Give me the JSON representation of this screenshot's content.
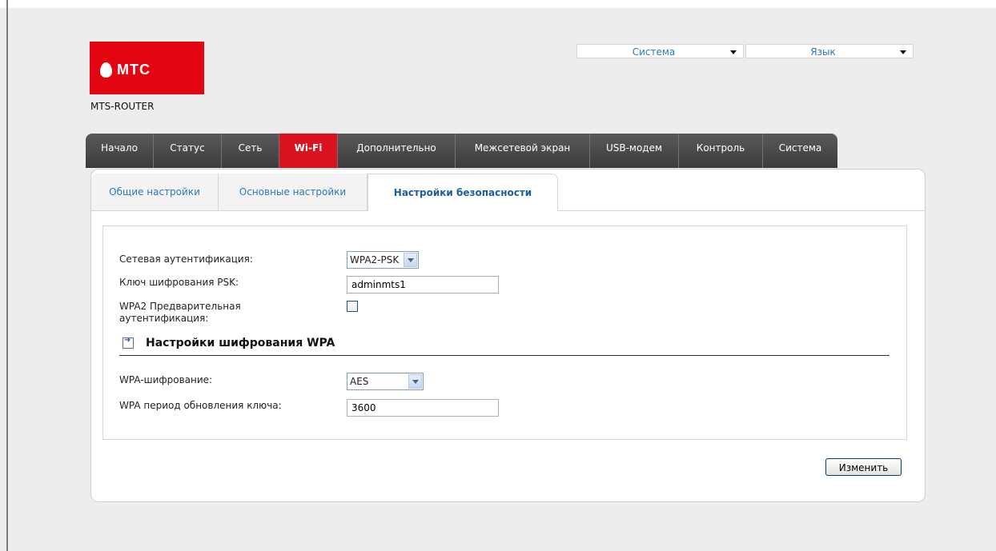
{
  "header": {
    "logo_text": "МТС",
    "device_name": "MTS-ROUTER",
    "system_menu": "Система",
    "language_menu": "Язык"
  },
  "main_tabs": [
    {
      "label": "Начало"
    },
    {
      "label": "Статус"
    },
    {
      "label": "Сеть"
    },
    {
      "label": "Wi-Fi",
      "active": true
    },
    {
      "label": "Дополнительно"
    },
    {
      "label": "Межсетевой экран"
    },
    {
      "label": "USB-модем"
    },
    {
      "label": "Контроль"
    },
    {
      "label": "Система"
    }
  ],
  "sub_tabs": [
    {
      "label": "Общие настройки"
    },
    {
      "label": "Основные настройки"
    },
    {
      "label": "Настройки безопасности",
      "active": true
    }
  ],
  "form": {
    "auth_label": "Сетевая аутентификация:",
    "auth_value": "WPA2-PSK",
    "psk_label": "Ключ шифрования PSK:",
    "psk_value": "adminmts1",
    "preauth_label_line1": "WPA2 Предварительная",
    "preauth_label_line2": "аутентификация:",
    "preauth_checked": false,
    "section_title": "Настройки шифрования WPA",
    "enc_label": "WPA-шифрование:",
    "enc_value": "AES",
    "rekey_label": "WPA период обновления ключа:",
    "rekey_value": "3600"
  },
  "actions": {
    "save_label": "Изменить"
  },
  "colors": {
    "brand_red": "#e30611",
    "tab_dark": "#4a4a4a",
    "link_blue": "#2f77b9"
  }
}
